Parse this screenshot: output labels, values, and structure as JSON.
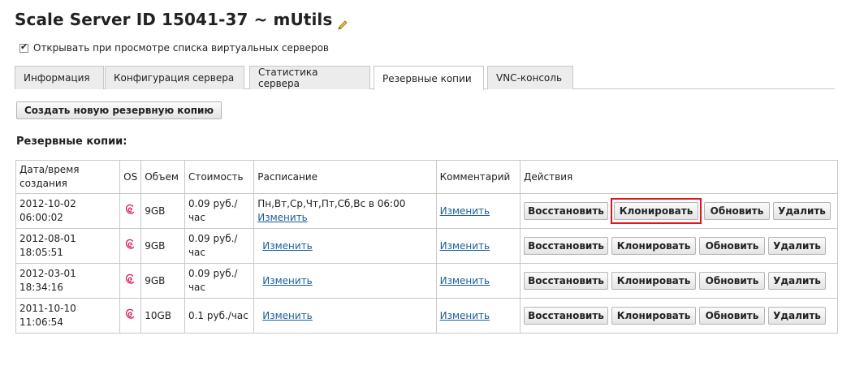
{
  "page": {
    "title": "Scale Server ID 15041-37 ~ mUtils",
    "open_on_list_label": "Открывать при просмотре списка виртуальных серверов",
    "open_on_list_checked": true
  },
  "tabs": [
    {
      "label": "Информация",
      "active": false
    },
    {
      "label": "Конфигурация сервера",
      "active": false
    },
    {
      "label": "Статистика сервера",
      "active": false
    },
    {
      "label": "Резервные копии",
      "active": true
    },
    {
      "label": "VNC-консоль",
      "active": false
    }
  ],
  "create_backup_label": "Создать новую резервную копию",
  "section_title": "Резервные копии:",
  "table": {
    "headers": {
      "datetime": "Дата/время создания",
      "os": "OS",
      "size": "Объем",
      "cost": "Стоимость",
      "schedule": "Расписание",
      "comment": "Комментарий",
      "actions": "Действия"
    },
    "rows": [
      {
        "datetime": "2012-10-02 06:00:02",
        "os_icon": "debian-icon",
        "size": "9GB",
        "cost": "0.09 руб./час",
        "schedule_text": "Пн,Вт,Ср,Чт,Пт,Сб,Вс в 06:00",
        "schedule_link": "Изменить",
        "comment_link": "Изменить"
      },
      {
        "datetime": "2012-08-01 18:05:51",
        "os_icon": "debian-icon",
        "size": "9GB",
        "cost": "0.09 руб./час",
        "schedule_text": "",
        "schedule_link": "Изменить",
        "comment_link": "Изменить"
      },
      {
        "datetime": "2012-03-01 18:34:16",
        "os_icon": "debian-icon",
        "size": "9GB",
        "cost": "0.09 руб./час",
        "schedule_text": "",
        "schedule_link": "Изменить",
        "comment_link": "Изменить"
      },
      {
        "datetime": "2011-10-10 11:06:54",
        "os_icon": "debian-icon",
        "size": "10GB",
        "cost": "0.1 руб./час",
        "schedule_text": "",
        "schedule_link": "Изменить",
        "comment_link": "Изменить"
      }
    ],
    "actions": {
      "restore": "Восстановить",
      "clone": "Клонировать",
      "update": "Обновить",
      "delete": "Удалить"
    }
  },
  "colors": {
    "highlight": "#e0161c",
    "link": "#1a5e9a",
    "debian": "#d70751"
  }
}
